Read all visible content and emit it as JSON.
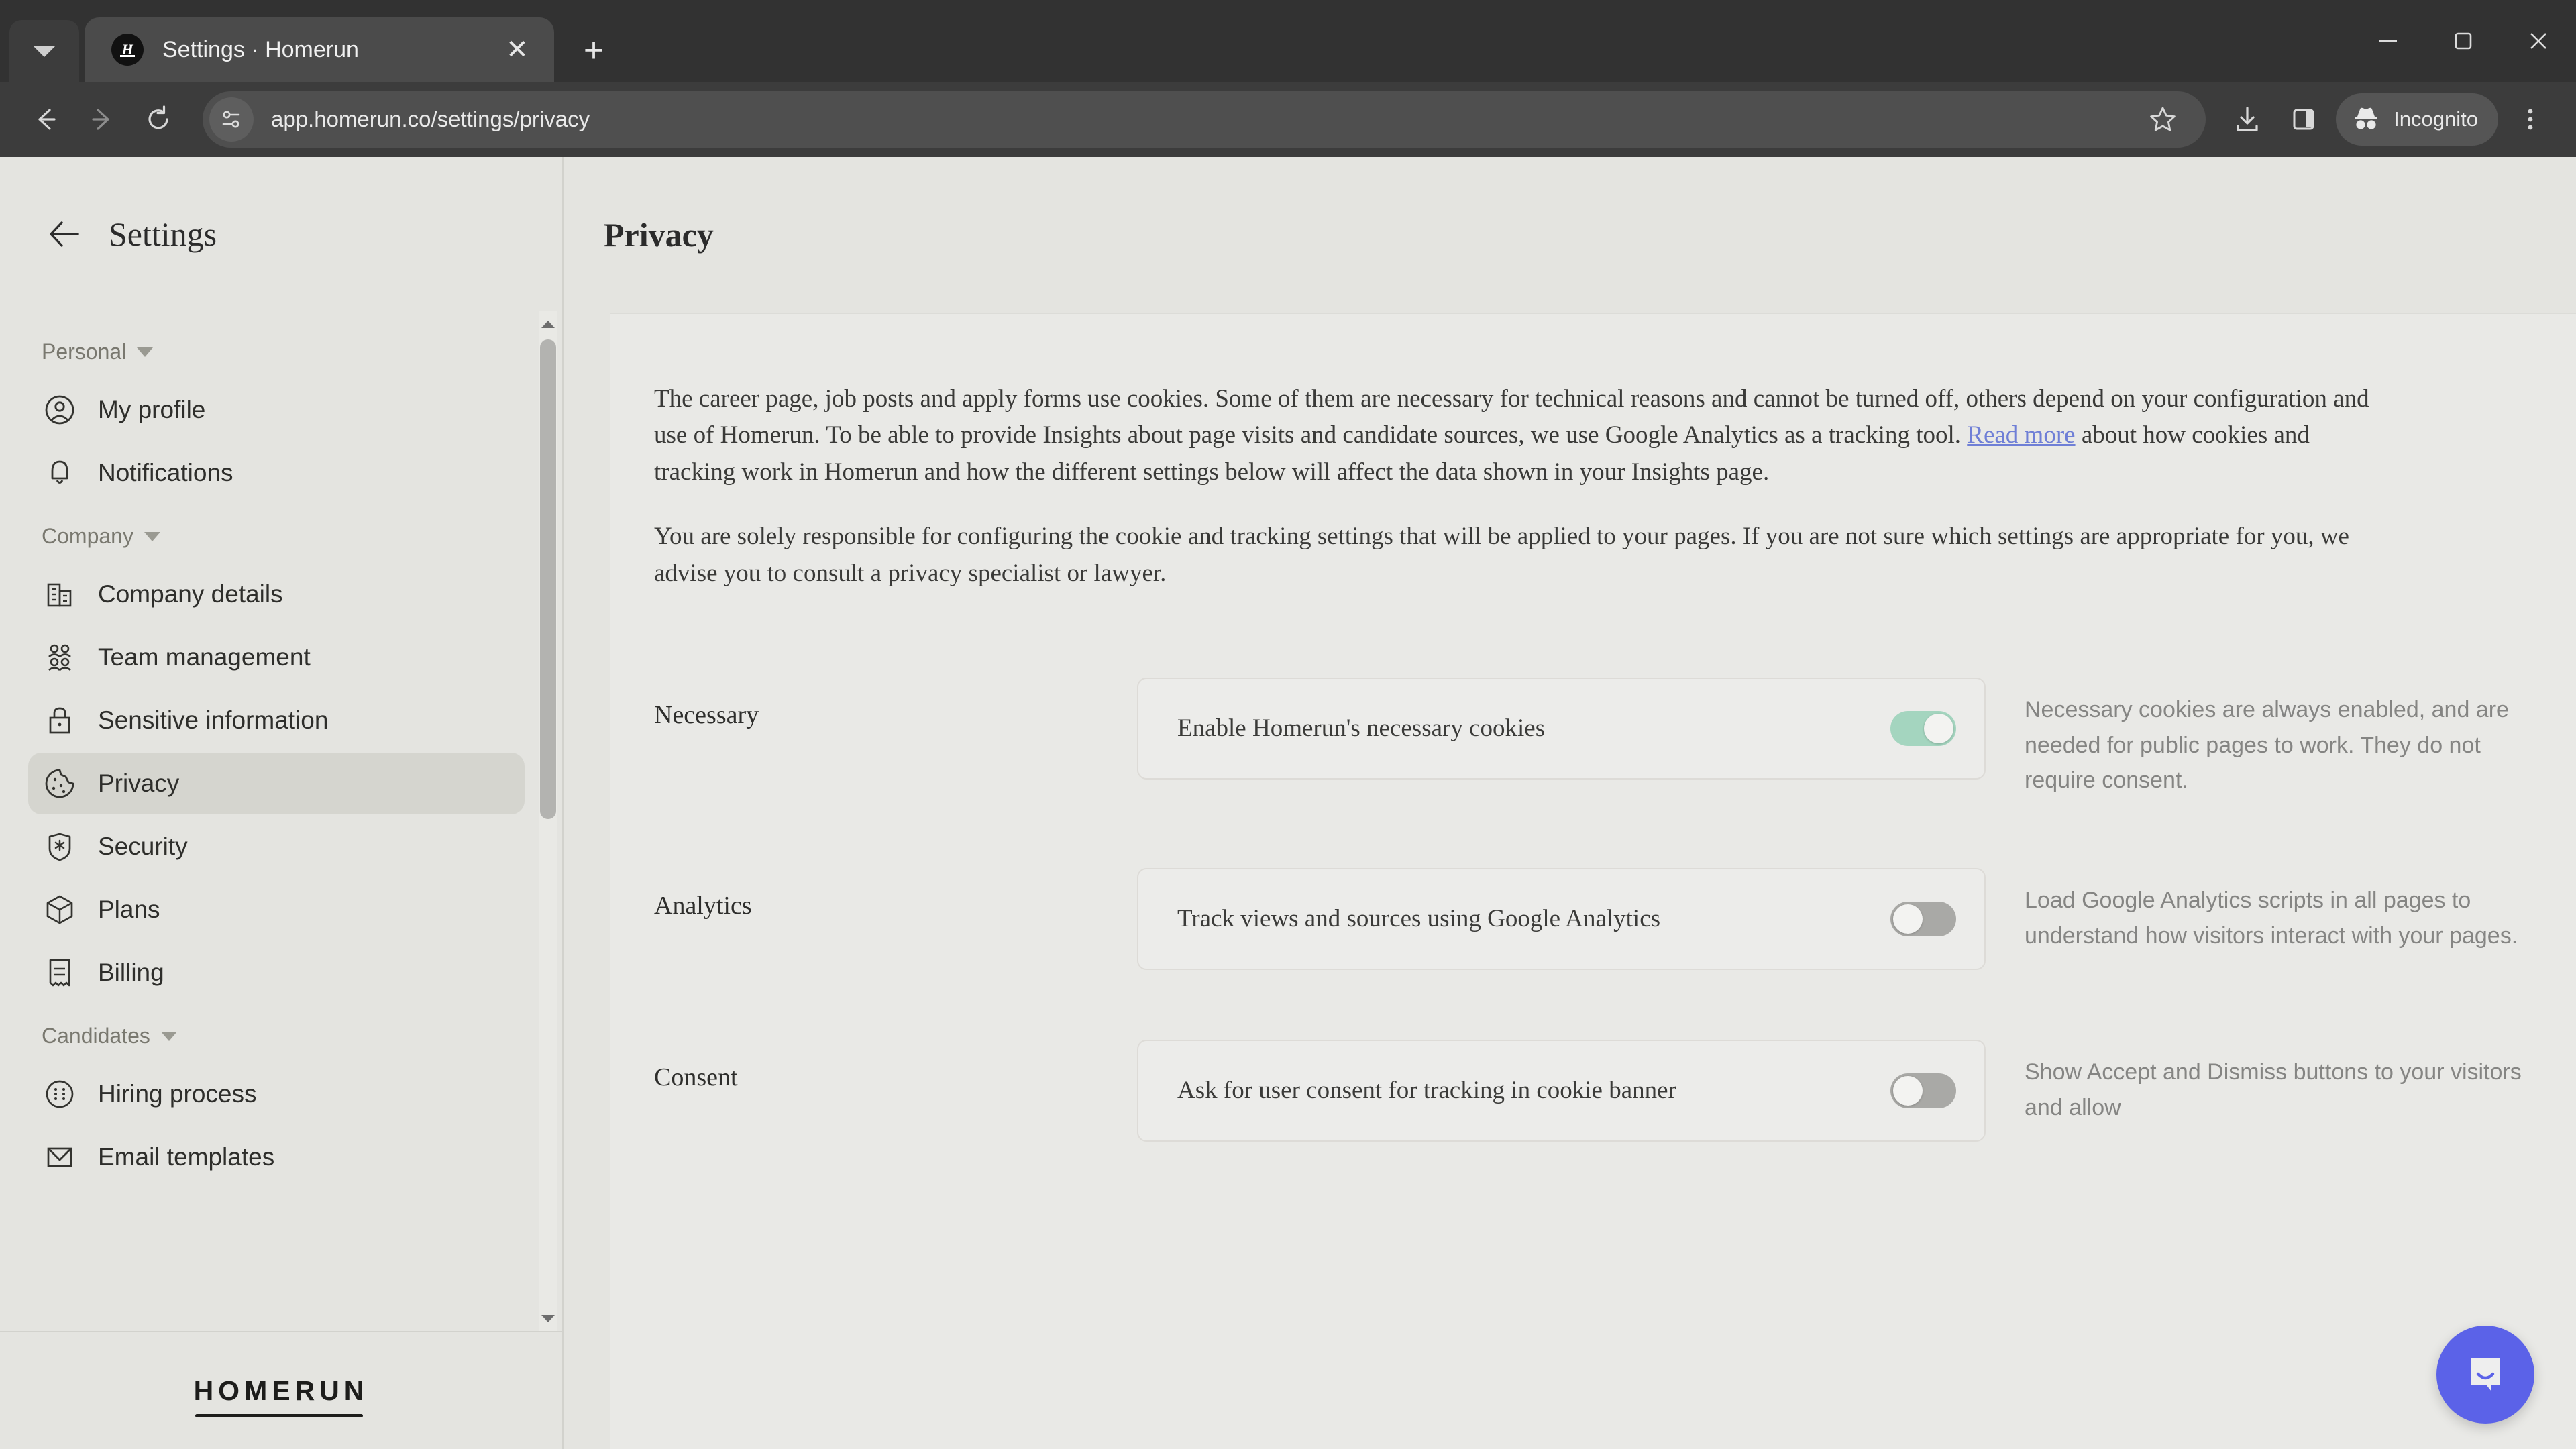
{
  "browser": {
    "tab": {
      "title": "Settings · Homerun",
      "favicon_letter": "H"
    },
    "new_tab_label": "+",
    "close_tab_label": "✕",
    "url": "app.homerun.co/settings/privacy",
    "profile_label": "Incognito",
    "icons": {
      "tab_list": "chevron-down-icon",
      "back": "back-arrow-icon",
      "forward": "forward-arrow-icon",
      "reload": "reload-icon",
      "site_info": "site-settings-icon",
      "bookmark": "star-icon",
      "downloads": "download-icon",
      "side_panel": "side-panel-icon",
      "incognito": "incognito-icon",
      "menu": "kebab-menu-icon",
      "minimize": "minimize-icon",
      "maximize": "maximize-icon",
      "close": "window-close-icon"
    }
  },
  "sidebar": {
    "title": "Settings",
    "groups": [
      {
        "label": "Personal",
        "items": [
          {
            "label": "My profile",
            "icon": "user-circle-icon",
            "active": false
          },
          {
            "label": "Notifications",
            "icon": "bell-icon",
            "active": false
          }
        ]
      },
      {
        "label": "Company",
        "items": [
          {
            "label": "Company details",
            "icon": "building-icon",
            "active": false
          },
          {
            "label": "Team management",
            "icon": "people-icon",
            "active": false
          },
          {
            "label": "Sensitive information",
            "icon": "lock-icon",
            "active": false
          },
          {
            "label": "Privacy",
            "icon": "cookie-icon",
            "active": true
          },
          {
            "label": "Security",
            "icon": "shield-star-icon",
            "active": false
          },
          {
            "label": "Plans",
            "icon": "box-icon",
            "active": false
          },
          {
            "label": "Billing",
            "icon": "receipt-icon",
            "active": false
          }
        ]
      },
      {
        "label": "Candidates",
        "items": [
          {
            "label": "Hiring process",
            "icon": "process-circle-icon",
            "active": false
          },
          {
            "label": "Email templates",
            "icon": "envelope-icon",
            "active": false
          }
        ]
      }
    ],
    "footer_wordmark": "HOMERUN"
  },
  "main": {
    "page_title": "Privacy",
    "paragraph_1_part_1": "The career page, job posts and apply forms use cookies. Some of them are necessary for technical reasons and cannot be turned off, others depend on your configuration and use of Homerun. To be able to provide Insights about page visits and candidate sources, we use Google Analytics as a tracking tool. ",
    "paragraph_1_link": "Read more",
    "paragraph_1_part_2": " about how cookies and tracking work in Homerun and how the different settings below will affect the data shown in your Insights page.",
    "paragraph_2": "You are solely responsible for configuring the cookie and tracking settings that will be applied to your pages. If you are not sure which settings are appropriate for you, we advise you to consult a privacy specialist or lawyer.",
    "rows": [
      {
        "label": "Necessary",
        "toggle_label": "Enable Homerun's necessary cookies",
        "toggle_state": "on",
        "description": "Necessary cookies are always enabled, and are needed for public pages to work. They do not require consent."
      },
      {
        "label": "Analytics",
        "toggle_label": "Track views and sources using Google Analytics",
        "toggle_state": "off",
        "description": "Load Google Analytics scripts in all pages to understand how visitors interact with your pages."
      },
      {
        "label": "Consent",
        "toggle_label": "Ask for user consent for tracking in cookie banner",
        "toggle_state": "off",
        "description": "Show Accept and Dismiss buttons to your visitors and allow"
      }
    ]
  },
  "widgets": {
    "chat_icon": "chat-bubble-icon"
  },
  "colors": {
    "accent_green": "#a4d5bf",
    "link_blue": "#6f7fd6",
    "chat_blue": "#5b62e8",
    "app_bg": "#e4e4e0",
    "content_bg": "#e9e9e6"
  }
}
